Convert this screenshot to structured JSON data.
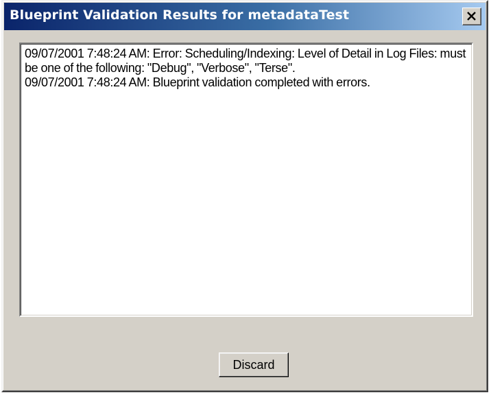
{
  "window": {
    "title": "Blueprint Validation Results for metadataTest",
    "close_icon": "close-icon"
  },
  "log": {
    "lines": [
      "09/07/2001 7:48:24 AM: Error: Scheduling/Indexing: Level of Detail in Log Files: must be one of the following: \"Debug\", \"Verbose\", \"Terse\".",
      "09/07/2001 7:48:24 AM: Blueprint validation completed with errors."
    ]
  },
  "buttons": {
    "discard_label": "Discard"
  },
  "colors": {
    "titlebar_start": "#0a246a",
    "titlebar_end": "#a6caf0",
    "dialog_face": "#d4d0c8"
  }
}
